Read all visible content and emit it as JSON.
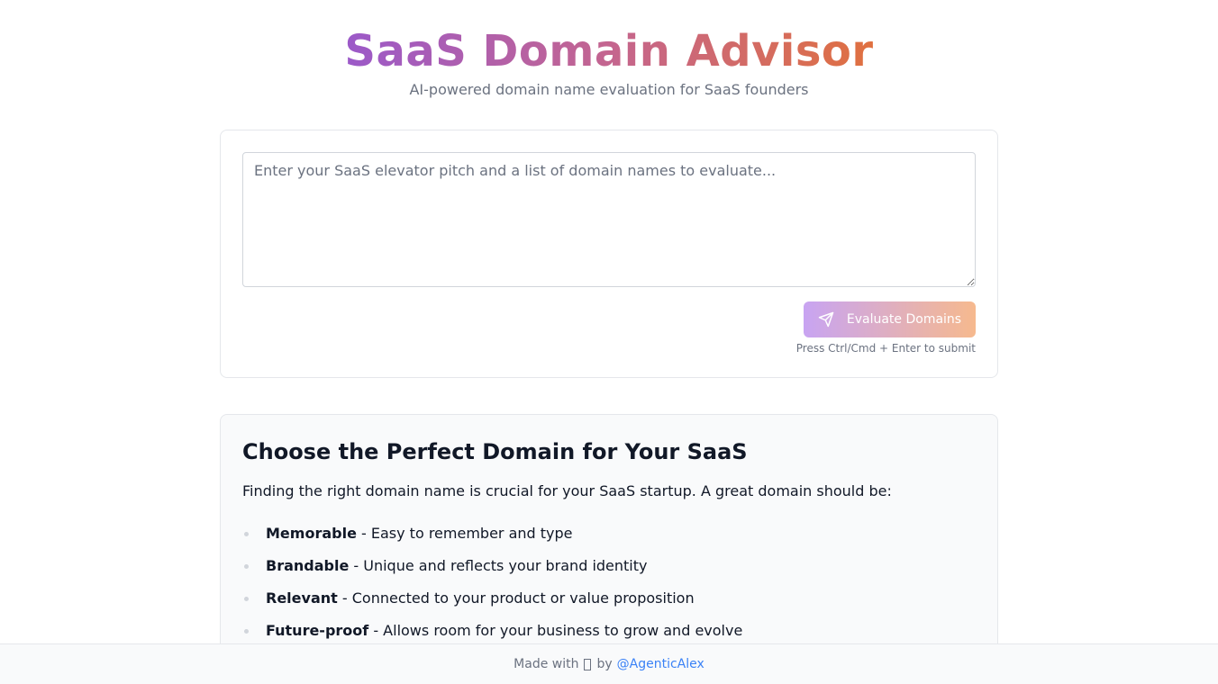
{
  "header": {
    "title": "SaaS Domain Advisor",
    "subtitle": "AI-powered domain name evaluation for SaaS founders"
  },
  "form": {
    "placeholder": "Enter your SaaS elevator pitch and a list of domain names to evaluate...",
    "value": "",
    "submit_label": "Evaluate Domains",
    "submit_icon": "send-icon",
    "hint": "Press Ctrl/Cmd + Enter to submit"
  },
  "info": {
    "title": "Choose the Perfect Domain for Your SaaS",
    "intro": "Finding the right domain name is crucial for your SaaS startup. A great domain should be:",
    "criteria": [
      {
        "term": "Memorable",
        "desc": " - Easy to remember and type"
      },
      {
        "term": "Brandable",
        "desc": " - Unique and reflects your brand identity"
      },
      {
        "term": "Relevant",
        "desc": " - Connected to your product or value proposition"
      },
      {
        "term": "Future-proof",
        "desc": " - Allows room for your business to grow and evolve"
      }
    ]
  },
  "footer": {
    "made_with": "Made with",
    "by": "by",
    "author": "@AgenticAlex"
  },
  "colors": {
    "title_gradient_start": "#9b59c9",
    "title_gradient_end": "#e0703f",
    "button_gradient_start": "#c8a4f2",
    "button_gradient_end": "#f6b98e",
    "link": "#3b82f6"
  }
}
